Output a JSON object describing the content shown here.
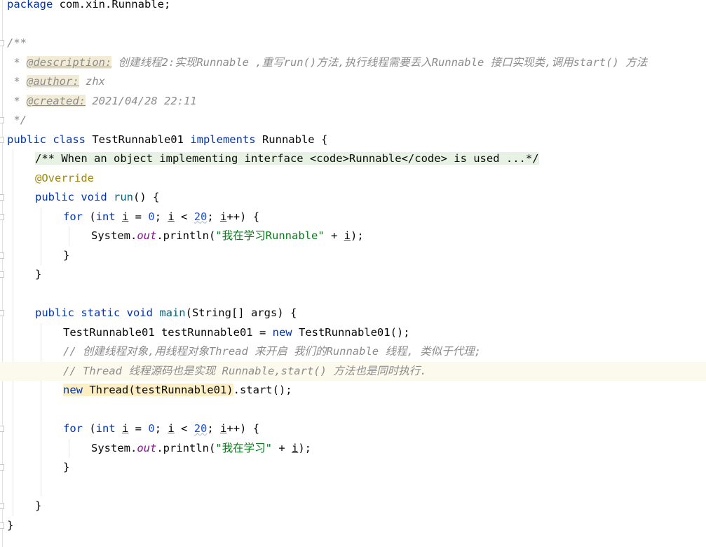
{
  "editor": {
    "file_language": "java",
    "current_line": 20,
    "colors": {
      "keyword": "#0033b3",
      "method": "#00627a",
      "number": "#1750eb",
      "string": "#067d17",
      "annotation": "#9e880d",
      "comment": "#8c8c8c",
      "field": "#871094",
      "current_line_bg": "#fcfaed",
      "folded_doc_bg": "#e8f2e4",
      "highlight_bg": "#fcefc4"
    },
    "lines": [
      {
        "indent": 0,
        "tokens": [
          [
            "kw",
            "package"
          ],
          [
            "p",
            " com.xin.Runnable;"
          ]
        ]
      },
      {
        "indent": 0,
        "tokens": []
      },
      {
        "indent": 0,
        "tokens": [
          [
            "doc",
            "/**"
          ]
        ]
      },
      {
        "indent": 0,
        "tokens": [
          [
            "doc",
            " * "
          ],
          [
            "tag",
            "@description:"
          ],
          [
            "doc",
            " 创建线程2:实现Runnable ,重写run()方法,执行线程需要丢入Runnable 接口实现类,调用start() 方法"
          ]
        ]
      },
      {
        "indent": 0,
        "tokens": [
          [
            "doc",
            " * "
          ],
          [
            "tag",
            "@author:"
          ],
          [
            "doc",
            " zhx"
          ]
        ]
      },
      {
        "indent": 0,
        "tokens": [
          [
            "doc",
            " * "
          ],
          [
            "tag",
            "@created:"
          ],
          [
            "doc",
            " 2021/04/28 22:11"
          ]
        ]
      },
      {
        "indent": 0,
        "tokens": [
          [
            "doc",
            " */"
          ]
        ]
      },
      {
        "indent": 0,
        "tokens": [
          [
            "kw",
            "public class "
          ],
          [
            "p",
            "TestRunnable01 "
          ],
          [
            "kw",
            "implements "
          ],
          [
            "p",
            "Runnable {"
          ]
        ]
      },
      {
        "indent": 1,
        "tokens": [
          [
            "fold-doc",
            "/** When an object implementing interface <code>Runnable</code> is used ...*/"
          ]
        ]
      },
      {
        "indent": 1,
        "tokens": [
          [
            "ann",
            "@Override"
          ]
        ]
      },
      {
        "indent": 1,
        "tokens": [
          [
            "kw",
            "public void "
          ],
          [
            "fn",
            "run"
          ],
          [
            "p",
            "() {"
          ]
        ]
      },
      {
        "indent": 2,
        "tokens": [
          [
            "kw",
            "for "
          ],
          [
            "p",
            "("
          ],
          [
            "kw",
            "int "
          ],
          [
            "var",
            "i"
          ],
          [
            "p",
            " = "
          ],
          [
            "num",
            "0"
          ],
          [
            "p",
            "; "
          ],
          [
            "var",
            "i"
          ],
          [
            "p",
            " < "
          ],
          [
            "numsq",
            "20"
          ],
          [
            "p",
            "; "
          ],
          [
            "var",
            "i"
          ],
          [
            "p",
            "++) {"
          ]
        ]
      },
      {
        "indent": 3,
        "tokens": [
          [
            "p",
            "System."
          ],
          [
            "fld",
            "out"
          ],
          [
            "p",
            ".println("
          ],
          [
            "str",
            "\"我在学习Runnable\""
          ],
          [
            "p",
            " + "
          ],
          [
            "var",
            "i"
          ],
          [
            "p",
            ");"
          ]
        ]
      },
      {
        "indent": 2,
        "tokens": [
          [
            "p",
            "}"
          ]
        ]
      },
      {
        "indent": 1,
        "tokens": [
          [
            "p",
            "}"
          ]
        ]
      },
      {
        "indent": 0,
        "tokens": []
      },
      {
        "indent": 1,
        "tokens": [
          [
            "kw",
            "public static void "
          ],
          [
            "fn",
            "main"
          ],
          [
            "p",
            "(String[] args) {"
          ]
        ]
      },
      {
        "indent": 2,
        "tokens": [
          [
            "p",
            "TestRunnable01 testRunnable01 = "
          ],
          [
            "kw",
            "new "
          ],
          [
            "p",
            "TestRunnable01();"
          ]
        ]
      },
      {
        "indent": 2,
        "tokens": [
          [
            "cmt",
            "// 创建线程对象,用线程对象Thread 来开启 我们的Runnable 线程, 类似于代理;"
          ]
        ]
      },
      {
        "indent": 2,
        "tokens": [
          [
            "cmt",
            "// Thread 线程源码也是实现 Runnable,start() 方法也是同时执行."
          ]
        ]
      },
      {
        "indent": 2,
        "tokens": [
          [
            "hlkw",
            "new "
          ],
          [
            "hl",
            "Thread(testRunnable01)"
          ],
          [
            "p",
            ".start();"
          ]
        ]
      },
      {
        "indent": 0,
        "tokens": []
      },
      {
        "indent": 2,
        "tokens": [
          [
            "kw",
            "for "
          ],
          [
            "p",
            "("
          ],
          [
            "kw",
            "int "
          ],
          [
            "var",
            "i"
          ],
          [
            "p",
            " = "
          ],
          [
            "num",
            "0"
          ],
          [
            "p",
            "; "
          ],
          [
            "var",
            "i"
          ],
          [
            "p",
            " < "
          ],
          [
            "numsq",
            "20"
          ],
          [
            "p",
            "; "
          ],
          [
            "var",
            "i"
          ],
          [
            "p",
            "++) {"
          ]
        ]
      },
      {
        "indent": 3,
        "tokens": [
          [
            "p",
            "System."
          ],
          [
            "fld",
            "out"
          ],
          [
            "p",
            ".println("
          ],
          [
            "str",
            "\"我在学习\""
          ],
          [
            "p",
            " + "
          ],
          [
            "var",
            "i"
          ],
          [
            "p",
            ");"
          ]
        ]
      },
      {
        "indent": 2,
        "tokens": [
          [
            "p",
            "}"
          ]
        ]
      },
      {
        "indent": 0,
        "tokens": []
      },
      {
        "indent": 1,
        "tokens": [
          [
            "p",
            "}"
          ]
        ]
      },
      {
        "indent": 0,
        "tokens": [
          [
            "p",
            "}"
          ]
        ]
      }
    ]
  }
}
